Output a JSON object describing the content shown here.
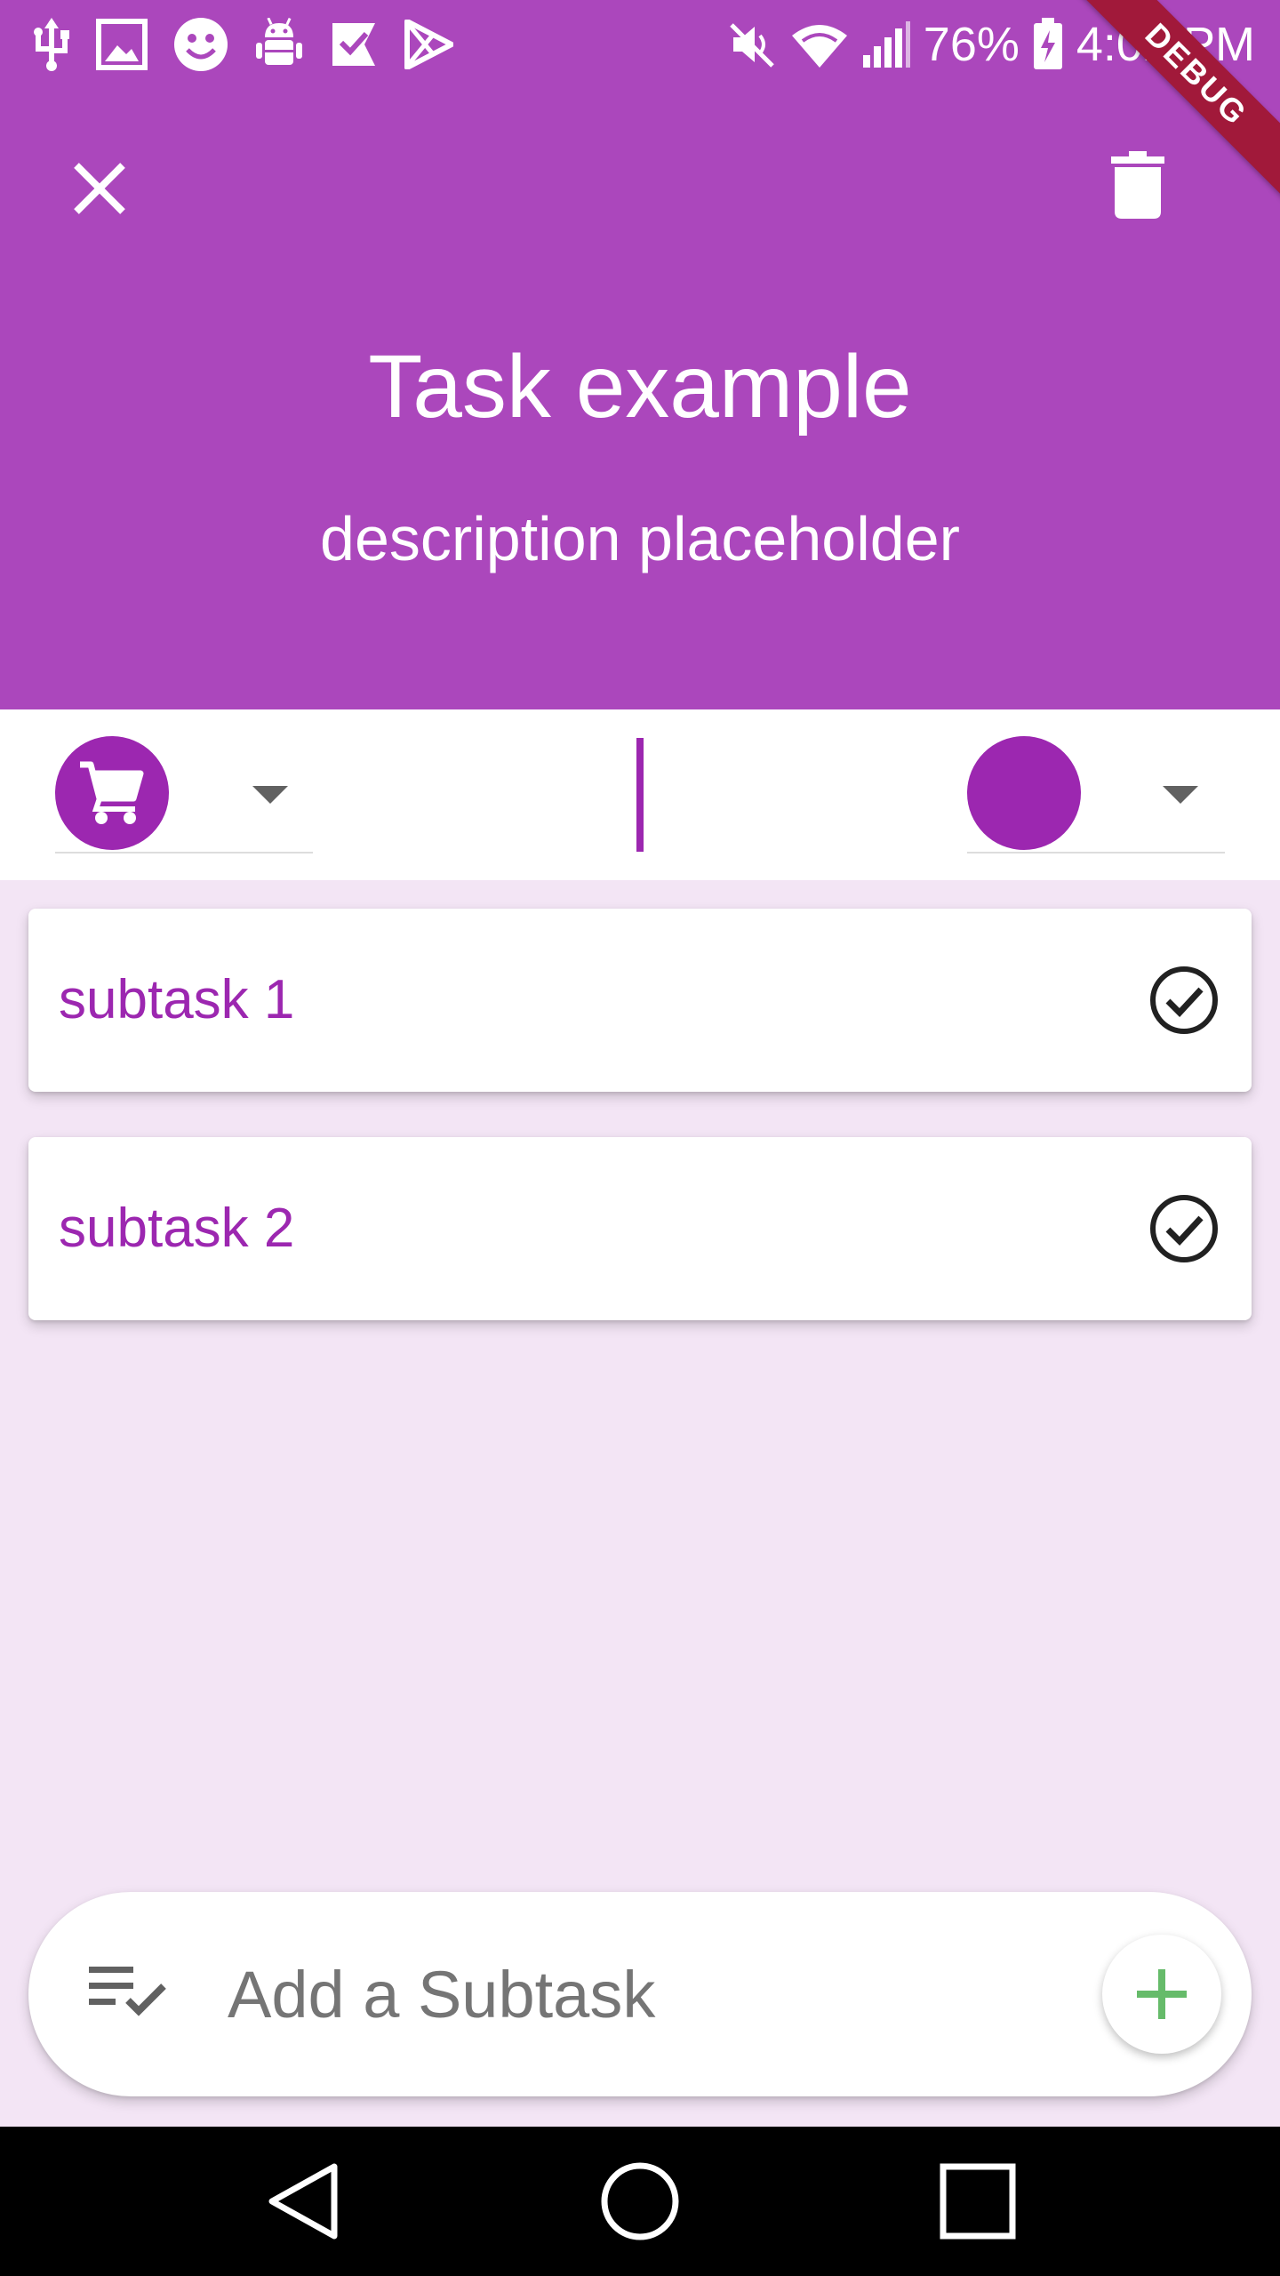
{
  "status_bar": {
    "battery": "76%",
    "time": "4:02 PM",
    "icons_left": [
      "usb-icon",
      "image-icon",
      "smiley-icon",
      "android-debug-icon",
      "check-app-icon",
      "play-store-icon"
    ],
    "icons_right": [
      "mute-icon",
      "wifi-icon",
      "signal-icon",
      "battery-charging-icon"
    ]
  },
  "header": {
    "title": "Task example",
    "description": "description placeholder",
    "debug_banner": "DEBUG",
    "close_icon": "close-icon",
    "delete_icon": "trash-icon"
  },
  "pickers": {
    "icon_picker": {
      "selected_icon": "shopping-cart-icon"
    },
    "color_picker": {
      "selected_color": "#9c27b0"
    }
  },
  "subtasks": [
    {
      "label": "subtask 1",
      "icon": "check-circle-icon"
    },
    {
      "label": "subtask 2",
      "icon": "check-circle-icon"
    }
  ],
  "add_subtask": {
    "placeholder": "Add a Subtask",
    "value": "",
    "icon": "playlist-check-icon",
    "add_icon": "plus-icon"
  },
  "nav_bar": {
    "back_icon": "back-triangle-icon",
    "home_icon": "home-circle-icon",
    "recents_icon": "recents-square-icon"
  },
  "colors": {
    "header_bg": "#ab47bc",
    "accent": "#9c27b0",
    "page_bg": "#f3e5f5",
    "plus_green": "#66bb6a"
  }
}
